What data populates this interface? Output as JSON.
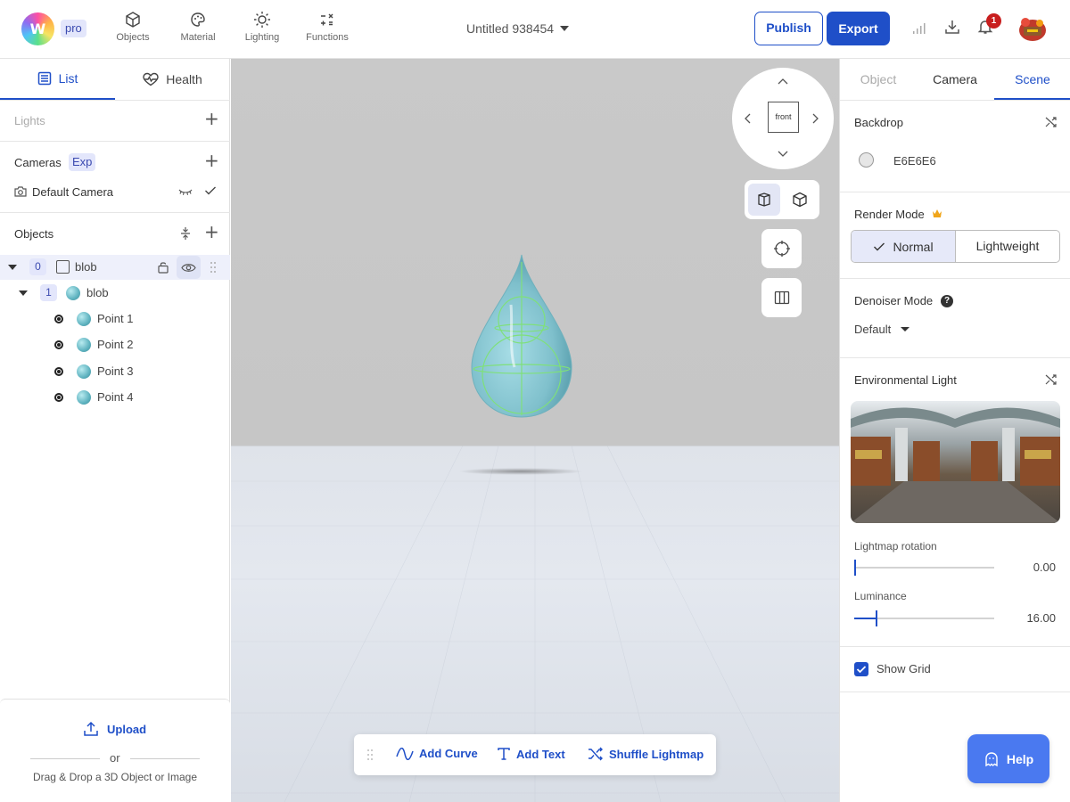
{
  "header": {
    "badge": "pro",
    "tools": [
      {
        "label": "Objects",
        "icon": "cube-icon"
      },
      {
        "label": "Material",
        "icon": "palette-icon"
      },
      {
        "label": "Lighting",
        "icon": "sun-icon"
      },
      {
        "label": "Functions",
        "icon": "calculator-icon"
      }
    ],
    "document_title": "Untitled 938454",
    "publish_label": "Publish",
    "export_label": "Export",
    "notification_count": "1"
  },
  "left_panel": {
    "tabs": [
      {
        "label": "List",
        "icon": "list-icon",
        "active": true
      },
      {
        "label": "Health",
        "icon": "heart-pulse-icon",
        "active": false
      }
    ],
    "lights_label": "Lights",
    "cameras_label": "Cameras",
    "cameras_badge": "Exp",
    "default_camera": "Default Camera",
    "objects_label": "Objects",
    "tree": [
      {
        "index": "0",
        "name": "blob",
        "level": 0
      },
      {
        "index": "1",
        "name": "blob",
        "level": 1
      },
      {
        "name": "Point 1",
        "level": 2
      },
      {
        "name": "Point 2",
        "level": 2
      },
      {
        "name": "Point 3",
        "level": 2
      },
      {
        "name": "Point 4",
        "level": 2
      }
    ],
    "upload_label": "Upload",
    "or_label": "or",
    "drop_hint": "Drag & Drop a 3D Object or Image"
  },
  "viewport": {
    "view_cube_label": "front",
    "toolbar": [
      {
        "label": "Add Curve",
        "icon": "curve-icon"
      },
      {
        "label": "Add Text",
        "icon": "text-icon"
      },
      {
        "label": "Shuffle Lightmap",
        "icon": "shuffle-icon"
      }
    ],
    "colors": {
      "backdrop": "#C9C9C9",
      "floor": "#E4E8EF",
      "accent": "#1F4FC8"
    }
  },
  "right_panel": {
    "tabs": [
      {
        "label": "Object",
        "state": "disabled"
      },
      {
        "label": "Camera",
        "state": "normal"
      },
      {
        "label": "Scene",
        "state": "active"
      }
    ],
    "backdrop_label": "Backdrop",
    "backdrop_color": "E6E6E6",
    "render_mode_label": "Render Mode",
    "render_modes": [
      "Normal",
      "Lightweight"
    ],
    "selected_render_mode": "Normal",
    "denoiser_label": "Denoiser Mode",
    "denoiser_value": "Default",
    "env_light_label": "Environmental Light",
    "lightmap_rotation_label": "Lightmap rotation",
    "lightmap_rotation_value": "0.00",
    "lightmap_rotation_fraction": 0.0,
    "luminance_label": "Luminance",
    "luminance_value": "16.00",
    "luminance_fraction": 0.16,
    "show_grid_label": "Show Grid",
    "show_grid_checked": true,
    "help_label": "Help"
  }
}
